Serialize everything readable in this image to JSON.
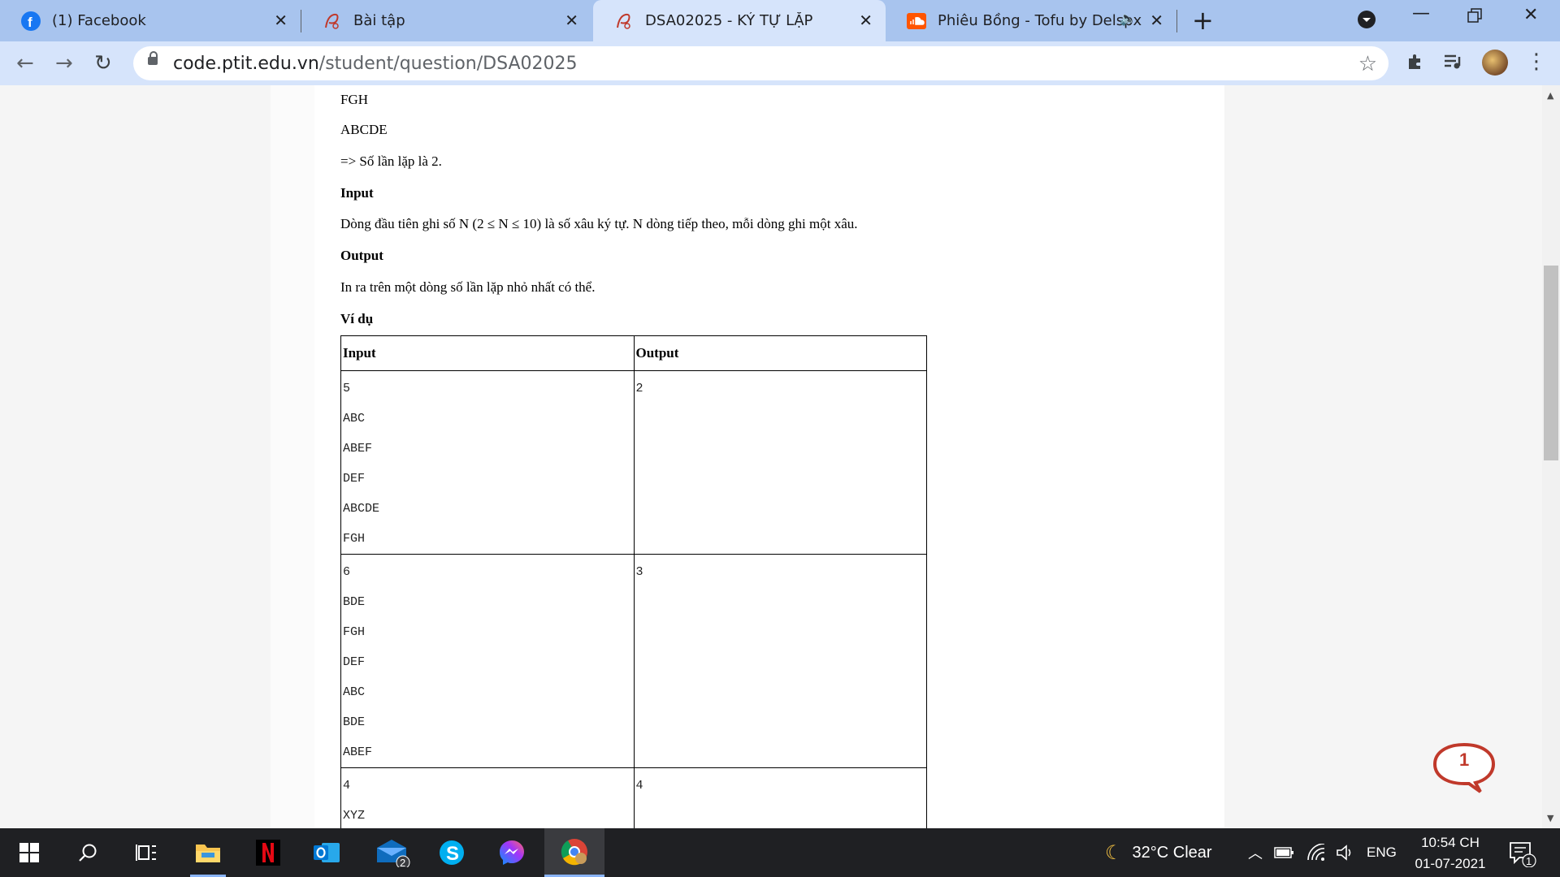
{
  "browser": {
    "tabs": [
      {
        "title": "(1) Facebook",
        "icon": "facebook-icon",
        "active": false
      },
      {
        "title": "Bài tập",
        "icon": "ptit-logo-icon",
        "active": false
      },
      {
        "title": "DSA02025 - KÝ TỰ LẶP",
        "icon": "ptit-logo-icon",
        "active": true
      },
      {
        "title": "Phiêu Bồng - Tofu by Delspx",
        "icon": "soundcloud-icon",
        "active": false
      }
    ],
    "url_domain": "code.ptit.edu.vn",
    "url_path": "/student/question/DSA02025"
  },
  "page": {
    "line1": "FGH",
    "line2": "ABCDE",
    "line3": "=> Số lần lặp là 2.",
    "input_heading": "Input",
    "input_desc": "Dòng đầu tiên ghi số N (2 ≤ N ≤ 10) là số xâu ký tự. N dòng tiếp theo, mỗi dòng ghi một xâu.",
    "output_heading": "Output",
    "output_desc": "In ra trên một dòng số lần lặp nhỏ nhất có thể.",
    "example_heading": "Ví dụ",
    "table": {
      "col_input": "Input",
      "col_output": "Output",
      "rows": [
        {
          "input": [
            "5",
            "ABC",
            "ABEF",
            "DEF",
            "ABCDE",
            "FGH"
          ],
          "output": "2"
        },
        {
          "input": [
            "6",
            "BDE",
            "FGH",
            "DEF",
            "ABC",
            "BDE",
            "ABEF"
          ],
          "output": "3"
        },
        {
          "input": [
            "4",
            "XYZ"
          ],
          "output": "4"
        }
      ]
    }
  },
  "chat_widget": {
    "badge": "1"
  },
  "taskbar": {
    "apps": [
      "windows-start-icon",
      "search-icon",
      "task-view-icon",
      "file-explorer-icon",
      "netflix-icon",
      "outlook-icon",
      "mail-icon",
      "skype-icon",
      "messenger-icon",
      "chrome-icon"
    ],
    "mail_badge": "2",
    "weather": "32°C  Clear",
    "language": "ENG",
    "time": "10:54 CH",
    "date": "01-07-2021",
    "notification_count": "1"
  },
  "colors": {
    "tabbar": "#a8c4ee",
    "active_tab": "#d6e4fb",
    "taskbar": "#1f2023",
    "chat_red": "#c0392b"
  }
}
